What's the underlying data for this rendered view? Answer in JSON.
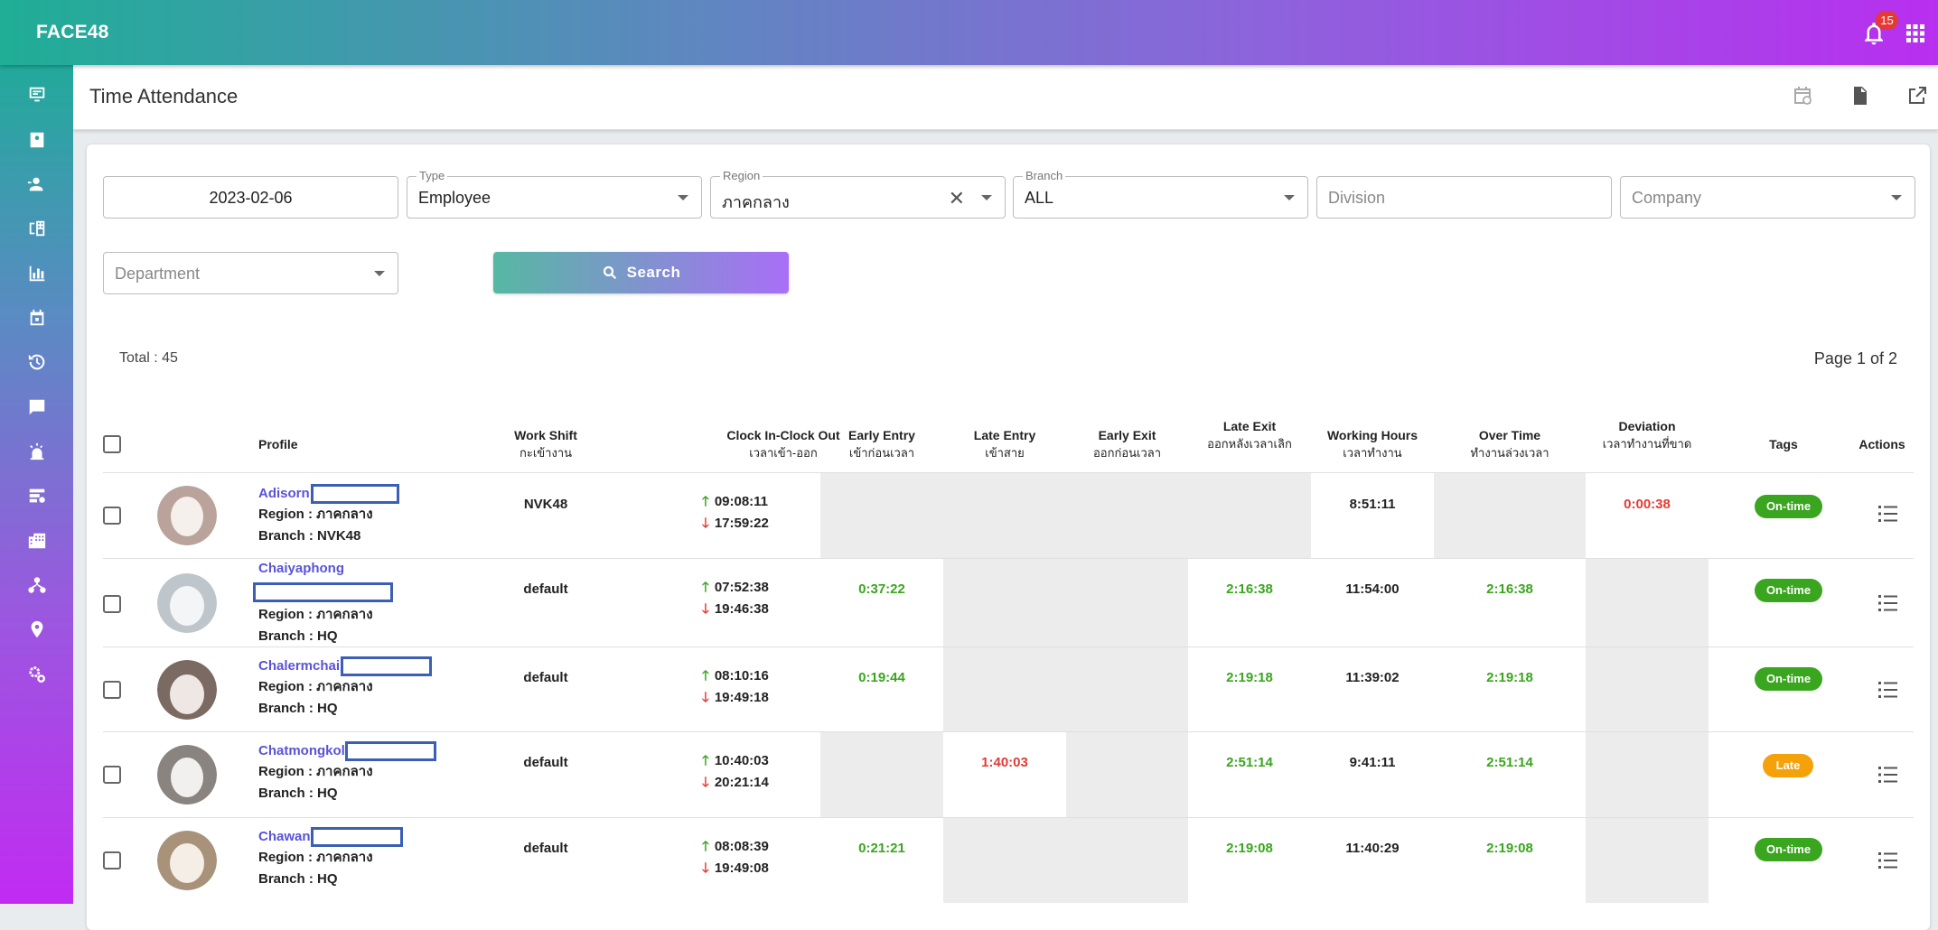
{
  "app": {
    "brand": "FACE48",
    "notification_count": "15"
  },
  "colors": {
    "accent_green": "#3aa51e",
    "accent_red": "#e53935",
    "link": "#5a53d8",
    "tag_on_time": "#3aa51e",
    "tag_late": "#f5a10a"
  },
  "sidebar": {
    "items": [
      {
        "icon": "monitor-icon"
      },
      {
        "icon": "contact-card-icon"
      },
      {
        "icon": "user-add-icon"
      },
      {
        "icon": "building-icon"
      },
      {
        "icon": "bar-chart-icon"
      },
      {
        "icon": "calendar-icon"
      },
      {
        "icon": "clock-history-icon"
      },
      {
        "icon": "chat-icon"
      },
      {
        "icon": "alarm-light-icon"
      },
      {
        "icon": "database-settings-icon"
      },
      {
        "icon": "office-building-icon"
      },
      {
        "icon": "hierarchy-icon"
      },
      {
        "icon": "location-pin-icon"
      },
      {
        "icon": "settings-cogs-icon"
      }
    ]
  },
  "header": {
    "title": "Time Attendance"
  },
  "filters": {
    "date": "2023-02-06",
    "type": {
      "label": "Type",
      "value": "Employee"
    },
    "region": {
      "label": "Region",
      "value": "ภาคกลาง"
    },
    "branch": {
      "label": "Branch",
      "value": "ALL"
    },
    "division": {
      "placeholder": "Division"
    },
    "company": {
      "placeholder": "Company"
    },
    "department": {
      "placeholder": "Department"
    },
    "search_label": "Search"
  },
  "summary": {
    "total": "Total : 45",
    "page": "Page 1 of 2"
  },
  "table": {
    "headers": {
      "profile": "Profile",
      "shift": "Work Shift",
      "shift_th": "กะเข้างาน",
      "clock": "Clock In-Clock Out",
      "clock_th": "เวลาเข้า-ออก",
      "early_entry": "Early Entry",
      "early_entry_th": "เข้าก่อนเวลา",
      "late_entry": "Late Entry",
      "late_entry_th": "เข้าสาย",
      "early_exit": "Early Exit",
      "early_exit_th": "ออกก่อนเวลา",
      "late_exit": "Late Exit",
      "late_exit_th": "ออกหลังเวลาเลิก",
      "hours": "Working Hours",
      "hours_th": "เวลาทำงาน",
      "overtime": "Over Time",
      "overtime_th": "ทำงานล่วงเวลา",
      "deviation": "Deviation",
      "deviation_th": "เวลาทำงานที่ขาด",
      "tags": "Tags",
      "actions": "Actions"
    },
    "rows": [
      {
        "name": "Adisorn",
        "region": "Region : ภาคกลาง",
        "branch": "Branch : NVK48",
        "shift": "NVK48",
        "in": "09:08:11",
        "out": "17:59:22",
        "early_entry": "",
        "late_entry": "",
        "early_exit": "",
        "late_exit": "",
        "hours": "8:51:11",
        "overtime": "",
        "deviation": "0:00:38",
        "tag": "On-time"
      },
      {
        "name": "Chaiyaphong",
        "region": "Region : ภาคกลาง",
        "branch": "Branch : HQ",
        "shift": "default",
        "in": "07:52:38",
        "out": "19:46:38",
        "early_entry": "0:37:22",
        "late_entry": "",
        "early_exit": "",
        "late_exit": "2:16:38",
        "hours": "11:54:00",
        "overtime": "2:16:38",
        "deviation": "",
        "tag": "On-time"
      },
      {
        "name": "Chalermchai",
        "region": "Region : ภาคกลาง",
        "branch": "Branch : HQ",
        "shift": "default",
        "in": "08:10:16",
        "out": "19:49:18",
        "early_entry": "0:19:44",
        "late_entry": "",
        "early_exit": "",
        "late_exit": "2:19:18",
        "hours": "11:39:02",
        "overtime": "2:19:18",
        "deviation": "",
        "tag": "On-time"
      },
      {
        "name": "Chatmongkol",
        "region": "Region : ภาคกลาง",
        "branch": "Branch : HQ",
        "shift": "default",
        "in": "10:40:03",
        "out": "20:21:14",
        "early_entry": "",
        "late_entry": "1:40:03",
        "early_exit": "",
        "late_exit": "2:51:14",
        "hours": "9:41:11",
        "overtime": "2:51:14",
        "deviation": "",
        "tag": "Late"
      },
      {
        "name": "Chawan",
        "region": "Region : ภาคกลาง",
        "branch": "Branch : HQ",
        "shift": "default",
        "in": "08:08:39",
        "out": "19:49:08",
        "early_entry": "0:21:21",
        "late_entry": "",
        "early_exit": "",
        "late_exit": "2:19:08",
        "hours": "11:40:29",
        "overtime": "2:19:08",
        "deviation": "",
        "tag": "On-time"
      }
    ]
  }
}
